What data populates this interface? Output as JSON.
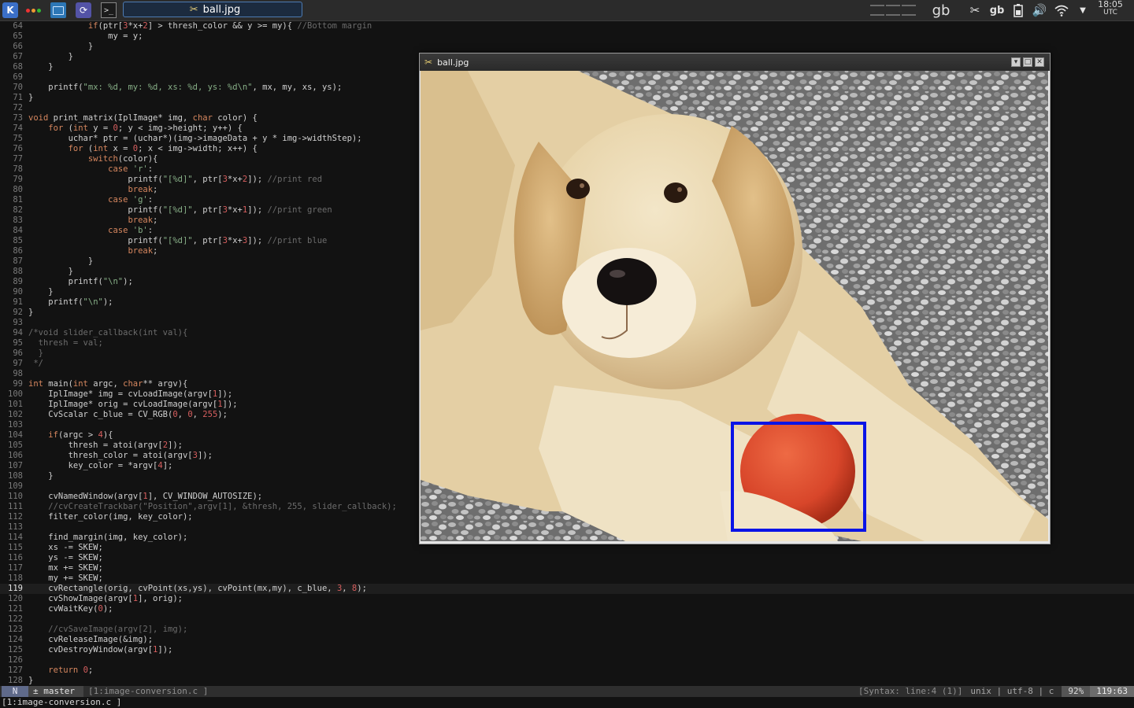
{
  "taskbar": {
    "kde_label": "K",
    "task_title": "ball.jpg",
    "tray_layout_1": "gb",
    "tray_layout_2": "gb",
    "clock_time": "18:05",
    "clock_zone": "UTC",
    "pager_desktops": 6,
    "pager_active_desktop": 6
  },
  "editor": {
    "lines": [
      {
        "n": "64",
        "t": "            if(ptr[3*x+2] > thresh_color && y >= my){ //Bottom margin"
      },
      {
        "n": "65",
        "t": "                my = y;"
      },
      {
        "n": "66",
        "t": "            }"
      },
      {
        "n": "67",
        "t": "        }"
      },
      {
        "n": "68",
        "t": "    }"
      },
      {
        "n": "69",
        "t": ""
      },
      {
        "n": "70",
        "t": "    printf(\"mx: %d, my: %d, xs: %d, ys: %d\\n\", mx, my, xs, ys);"
      },
      {
        "n": "71",
        "t": "}"
      },
      {
        "n": "72",
        "t": ""
      },
      {
        "n": "73",
        "t": "void print_matrix(IplImage* img, char color) {"
      },
      {
        "n": "74",
        "t": "    for (int y = 0; y < img->height; y++) {"
      },
      {
        "n": "75",
        "t": "        uchar* ptr = (uchar*)(img->imageData + y * img->widthStep);"
      },
      {
        "n": "76",
        "t": "        for (int x = 0; x < img->width; x++) {"
      },
      {
        "n": "77",
        "t": "            switch(color){"
      },
      {
        "n": "78",
        "t": "                case 'r':"
      },
      {
        "n": "79",
        "t": "                    printf(\"[%d]\", ptr[3*x+2]); //print red"
      },
      {
        "n": "80",
        "t": "                    break;"
      },
      {
        "n": "81",
        "t": "                case 'g':"
      },
      {
        "n": "82",
        "t": "                    printf(\"[%d]\", ptr[3*x+1]); //print green"
      },
      {
        "n": "83",
        "t": "                    break;"
      },
      {
        "n": "84",
        "t": "                case 'b':"
      },
      {
        "n": "85",
        "t": "                    printf(\"[%d]\", ptr[3*x+3]); //print blue"
      },
      {
        "n": "86",
        "t": "                    break;"
      },
      {
        "n": "87",
        "t": "            }"
      },
      {
        "n": "88",
        "t": "        }"
      },
      {
        "n": "89",
        "t": "        printf(\"\\n\");"
      },
      {
        "n": "90",
        "t": "    }"
      },
      {
        "n": "91",
        "t": "    printf(\"\\n\");"
      },
      {
        "n": "92",
        "t": "}"
      },
      {
        "n": "93",
        "t": ""
      },
      {
        "n": "94",
        "t": "/*void slider_callback(int val){"
      },
      {
        "n": "95",
        "t": "  thresh = val;"
      },
      {
        "n": "96",
        "t": "  }"
      },
      {
        "n": "97",
        "t": " */"
      },
      {
        "n": "98",
        "t": ""
      },
      {
        "n": "99",
        "t": "int main(int argc, char** argv){"
      },
      {
        "n": "100",
        "t": "    IplImage* img = cvLoadImage(argv[1]);"
      },
      {
        "n": "101",
        "t": "    IplImage* orig = cvLoadImage(argv[1]);"
      },
      {
        "n": "102",
        "t": "    CvScalar c_blue = CV_RGB(0, 0, 255);"
      },
      {
        "n": "103",
        "t": ""
      },
      {
        "n": "104",
        "t": "    if(argc > 4){"
      },
      {
        "n": "105",
        "t": "        thresh = atoi(argv[2]);"
      },
      {
        "n": "106",
        "t": "        thresh_color = atoi(argv[3]);"
      },
      {
        "n": "107",
        "t": "        key_color = *argv[4];"
      },
      {
        "n": "108",
        "t": "    }"
      },
      {
        "n": "109",
        "t": ""
      },
      {
        "n": "110",
        "t": "    cvNamedWindow(argv[1], CV_WINDOW_AUTOSIZE);"
      },
      {
        "n": "111",
        "t": "    //cvCreateTrackbar(\"Position\",argv[1], &thresh, 255, slider_callback);"
      },
      {
        "n": "112",
        "t": "    filter_color(img, key_color);"
      },
      {
        "n": "113",
        "t": ""
      },
      {
        "n": "114",
        "t": "    find_margin(img, key_color);"
      },
      {
        "n": "115",
        "t": "    xs -= SKEW;"
      },
      {
        "n": "116",
        "t": "    ys -= SKEW;"
      },
      {
        "n": "117",
        "t": "    mx += SKEW;"
      },
      {
        "n": "118",
        "t": "    my += SKEW;"
      },
      {
        "n": "119",
        "t": "    cvRectangle(orig, cvPoint(xs,ys), cvPoint(mx,my), c_blue, 3, 8);"
      },
      {
        "n": "120",
        "t": "    cvShowImage(argv[1], orig);"
      },
      {
        "n": "121",
        "t": "    cvWaitKey(0);"
      },
      {
        "n": "122",
        "t": ""
      },
      {
        "n": "123",
        "t": "    //cvSaveImage(argv[2], img);"
      },
      {
        "n": "124",
        "t": "    cvReleaseImage(&img);"
      },
      {
        "n": "125",
        "t": "    cvDestroyWindow(argv[1]);"
      },
      {
        "n": "126",
        "t": ""
      },
      {
        "n": "127",
        "t": "    return 0;"
      },
      {
        "n": "128",
        "t": "}"
      }
    ],
    "current_line": "119"
  },
  "statusbar": {
    "mode": "N",
    "branch": "± master",
    "filename": "[1:image-conversion.c ]",
    "syntax": "[Syntax: line:4 (1)]",
    "encoding": "unix | utf-8 | c",
    "percent": "92%",
    "position": "119:63"
  },
  "cmdline": {
    "text": "[1:image-conversion.c ]"
  },
  "image_window": {
    "title": "ball.jpg",
    "minimize_icon": "chevron-down-icon",
    "maximize_icon": "square-icon",
    "close_icon": "close-icon"
  },
  "colors": {
    "keyword": "#d7875f",
    "number": "#d75f5f",
    "string": "#87af87",
    "comment": "#6c6c6c",
    "rectangle": "#0a14e6",
    "ball": "#d8462a"
  }
}
